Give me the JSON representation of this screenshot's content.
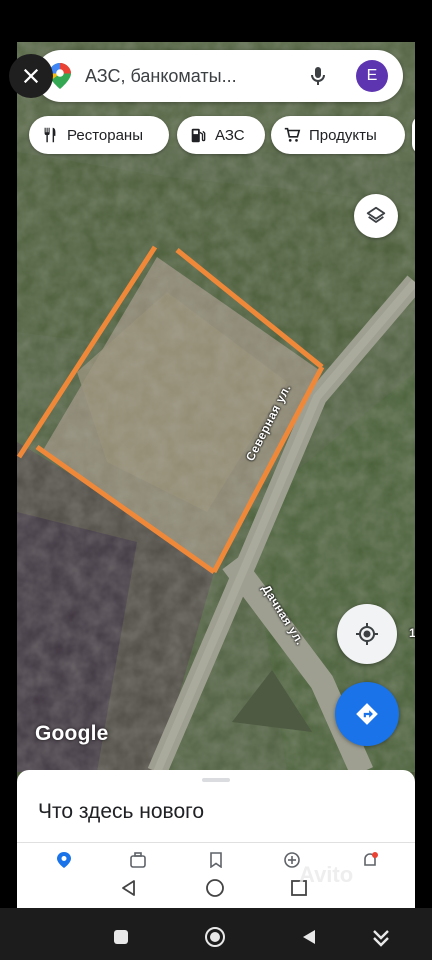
{
  "search": {
    "placeholder": "АЗС, банкоматы...",
    "avatar_letter": "E"
  },
  "chips": [
    {
      "label": "Рестораны",
      "icon": "restaurant-icon"
    },
    {
      "label": "АЗС",
      "icon": "gas-station-icon"
    },
    {
      "label": "Продукты",
      "icon": "cart-icon"
    }
  ],
  "map": {
    "streets": [
      "Северная ул.",
      "Дачная ул."
    ],
    "attribution": "Google",
    "edge_label": "1",
    "colors": {
      "plot_outline": "#f0883a",
      "road": "#a7a89a"
    }
  },
  "controls": {
    "close_icon": "close-icon",
    "layers_icon": "layers-icon",
    "mylocation_icon": "my-location-icon",
    "directions_icon": "directions-icon"
  },
  "sheet": {
    "title": "Что здесь нового"
  },
  "tabs": [
    "explore-icon",
    "go-icon",
    "saved-icon",
    "contribute-icon",
    "updates-icon"
  ],
  "system_nav": [
    "back-icon",
    "home-icon",
    "recents-icon"
  ],
  "watermark": "Avito",
  "colors": {
    "accent": "#1a73e8",
    "avatar": "#5e35b1"
  }
}
